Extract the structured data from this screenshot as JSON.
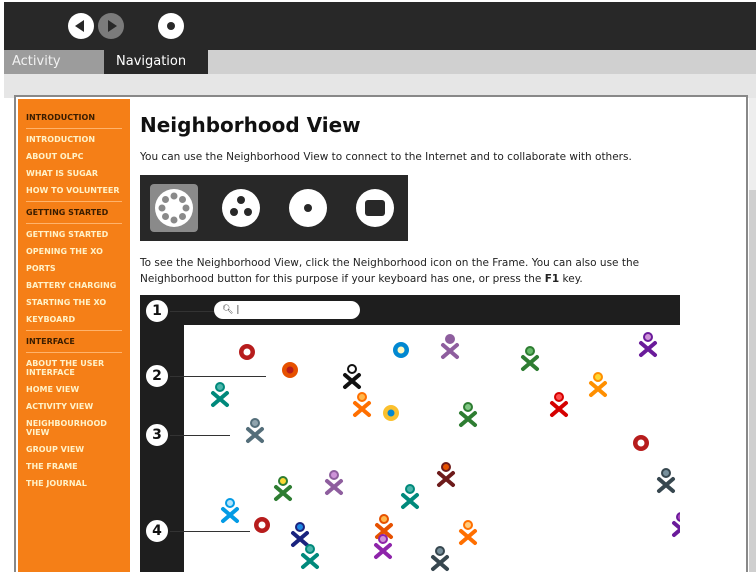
{
  "tabs": {
    "activity": "Activity",
    "navigation": "Navigation"
  },
  "sidebar": {
    "items": [
      {
        "label": "INTRODUCTION",
        "head": true
      },
      {
        "label": "INTRODUCTION"
      },
      {
        "label": "ABOUT OLPC"
      },
      {
        "label": "WHAT IS SUGAR"
      },
      {
        "label": "HOW TO VOLUNTEER"
      },
      {
        "label": "GETTING STARTED",
        "head": true
      },
      {
        "label": "GETTING STARTED"
      },
      {
        "label": "OPENING THE XO"
      },
      {
        "label": "PORTS"
      },
      {
        "label": "BATTERY CHARGING"
      },
      {
        "label": "STARTING THE XO"
      },
      {
        "label": "KEYBOARD"
      },
      {
        "label": "INTERFACE",
        "head": true
      },
      {
        "label": "ABOUT THE USER INTERFACE"
      },
      {
        "label": "HOME VIEW"
      },
      {
        "label": "ACTIVITY VIEW"
      },
      {
        "label": "NEIGHBOURHOOD VIEW"
      },
      {
        "label": "GROUP VIEW"
      },
      {
        "label": "THE FRAME"
      },
      {
        "label": "THE JOURNAL"
      }
    ]
  },
  "page": {
    "title": "Neighborhood View",
    "intro": "You can use the Neighborhood View to connect to the Internet and to collaborate with others.",
    "instructions_pre": "To see the Neighborhood View, click the Neighborhood icon on the Frame. You can also use the Neighborhood button for this purpose if your keyboard has one, or press the ",
    "instructions_key": "F1",
    "instructions_post": " key."
  },
  "screenshot": {
    "search_text": "|",
    "callouts": [
      "1",
      "2",
      "3",
      "4"
    ]
  },
  "colors": {
    "toolbar": "#282828",
    "sidebar": "#f57f17",
    "accent_text": "#fff2c8"
  }
}
